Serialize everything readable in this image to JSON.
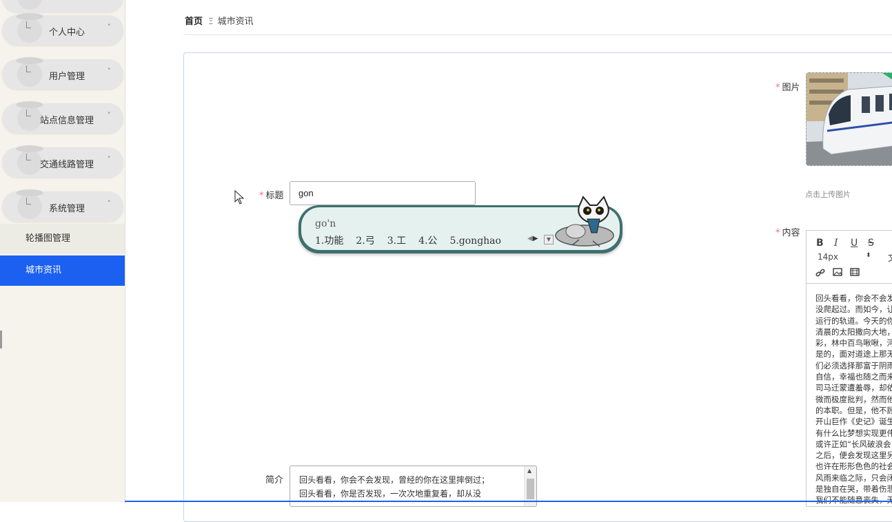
{
  "sidebar": {
    "menus": [
      {
        "label": "个人中心",
        "chevron": "˅"
      },
      {
        "label": "用户管理",
        "chevron": "˅"
      },
      {
        "label": "站点信息管理",
        "chevron": "˅"
      },
      {
        "label": "交通线路管理",
        "chevron": "˅"
      },
      {
        "label": "系统管理",
        "chevron": "˄"
      }
    ],
    "sub_items": [
      "轮播图管理",
      "城市资讯"
    ],
    "active_sub": "城市资讯"
  },
  "breadcrumb": {
    "home": "首页",
    "separator": "Ξ",
    "current": "城市资讯"
  },
  "form": {
    "title_label": "标题",
    "title_value": "gon",
    "image_label": "图片",
    "upload_hint": "点击上传图片",
    "content_label": "内容",
    "summary_label": "简介",
    "summary_lines": [
      "回头看看，你会不会发现，曾经的你在这里摔倒过；",
      "回头看看，你是否发现，一次次地重复着，却从没"
    ],
    "required_mark": "*"
  },
  "ime": {
    "composition": "go'n",
    "candidates": [
      "1.功能",
      "2.弓",
      "3.工",
      "4.公",
      "5.gonghao"
    ],
    "menu_icon": "dropdown-icon"
  },
  "editor": {
    "toolbar": {
      "bold": "B",
      "italic": "I",
      "underline": "U",
      "strike": "S",
      "font_size": "14px",
      "more": "文"
    },
    "icons": [
      "link-icon",
      "image-icon",
      "video-icon"
    ],
    "lines": [
      "回头看看，你会不会发",
      "没爬起过。而如今，让",
      "运行的轨道。今天的你",
      "清晨的太阳撒向大地，",
      "彩，林中百鸟啾啾，河",
      "是的，面对道途上那无",
      "们必须选择那富于阴雨",
      "自信，幸福也随之而来",
      "司马迁蒙遭羞辱，却依",
      "微而极度批判，然而他",
      "的本职。但是，他不顾",
      "开山巨作《史记》诞生",
      "有什么比梦想实现更伟",
      "或许正如“长风破浪会",
      "之后，便会发现这里另",
      "也许在形形色色的社会",
      "风雨来临之际，只会闭",
      "是独自在哭，带着伤悲",
      "我们不能随意丧失，无"
    ]
  },
  "colors": {
    "accent": "#1c60f2",
    "required": "#f56c6c",
    "ime_border": "#3f6f6f"
  }
}
